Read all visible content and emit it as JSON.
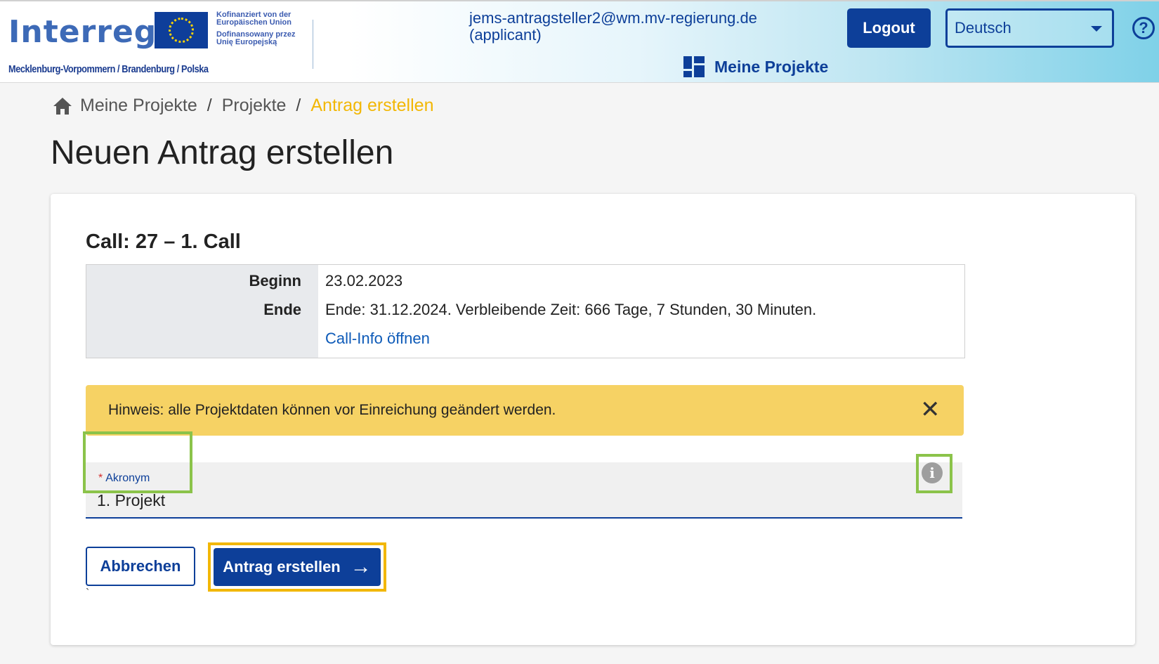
{
  "header": {
    "logo_text": "Interreg",
    "cofinanced_lines": [
      "Kofinanziert von der",
      "Europäischen Union",
      "Dofinansowany przez",
      "Unię Europejską"
    ],
    "region": "Mecklenburg-Vorpommern / Brandenburg / Polska",
    "user_email": "jems-antragsteller2@wm.mv-regierung.de",
    "user_role": "(applicant)",
    "logout_label": "Logout",
    "language": "Deutsch",
    "help_glyph": "?",
    "nav_label": "Meine Projekte"
  },
  "breadcrumb": {
    "items": [
      "Meine Projekte",
      "Projekte"
    ],
    "current": "Antrag erstellen",
    "separator": "/"
  },
  "page": {
    "title": "Neuen Antrag erstellen"
  },
  "call": {
    "title": "Call: 27 – 1. Call",
    "start_label": "Beginn",
    "start_value": "23.02.2023",
    "end_label": "Ende",
    "end_value": "Ende: 31.12.2024. Verbleibende Zeit: 666 Tage, 7 Stunden, 30 Minuten.",
    "info_link": "Call-Info öffnen"
  },
  "notice": {
    "text": "Hinweis: alle Projektdaten können vor Einreichung geändert werden.",
    "close_glyph": "✕"
  },
  "form": {
    "required_mark": "*",
    "acronym_label": "Akronym",
    "acronym_value": "1. Projekt",
    "info_glyph": "i"
  },
  "actions": {
    "cancel_label": "Abbrechen",
    "create_label": "Antrag erstellen",
    "arrow_glyph": "→",
    "stray_mark": "`"
  },
  "colors": {
    "primary": "#0d3f99",
    "accent_yellow": "#f2b705",
    "notice_bg": "#f6d264",
    "highlight_green": "#8bc34a"
  },
  "icons": [
    "eu-flag-icon",
    "help-icon",
    "grid-icon",
    "home-icon",
    "close-icon",
    "info-icon",
    "arrow-right-icon",
    "caret-down-icon"
  ]
}
